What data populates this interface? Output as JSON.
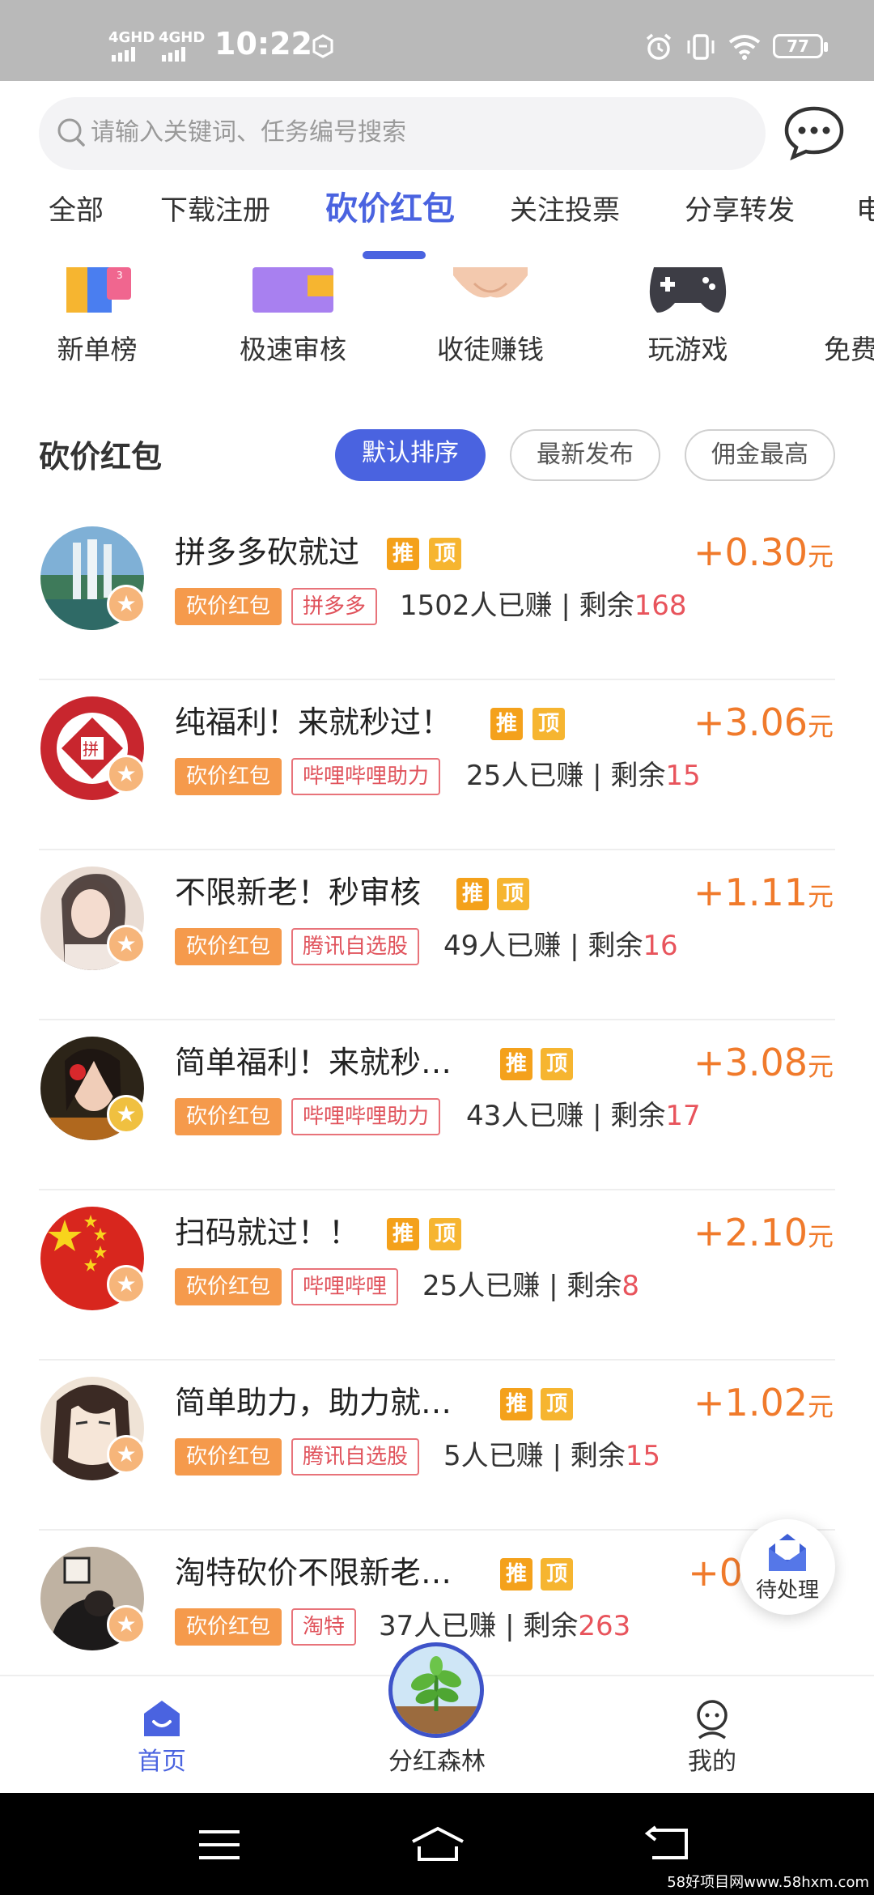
{
  "status_bar": {
    "net1": "4GHD",
    "net2": "4GHD",
    "time": "10:22",
    "battery": "77"
  },
  "search": {
    "placeholder": "请输入关键词、任务编号搜索"
  },
  "tabs": [
    {
      "label": "全部"
    },
    {
      "label": "下载注册"
    },
    {
      "label": "砍价红包",
      "active": true
    },
    {
      "label": "关注投票"
    },
    {
      "label": "分享转发"
    },
    {
      "label": "电"
    }
  ],
  "categories": [
    {
      "label": "新单榜",
      "icon": "trophy-book-icon"
    },
    {
      "label": "极速审核",
      "icon": "purple-folder-icon"
    },
    {
      "label": "收徒赚钱",
      "icon": "handshake-icon"
    },
    {
      "label": "玩游戏",
      "icon": "gamepad-icon"
    },
    {
      "label": "免费",
      "icon": "orange-card-icon"
    }
  ],
  "section": {
    "title": "砍价红包",
    "sort_options": [
      {
        "label": "默认排序",
        "active": true
      },
      {
        "label": "最新发布",
        "active": false
      },
      {
        "label": "佣金最高",
        "active": false
      }
    ]
  },
  "task_badges": {
    "tui": "推",
    "ding": "顶"
  },
  "tasks": [
    {
      "title": "拼多多砍就过",
      "price": "+0.30",
      "unit": "元",
      "tag1": "砍价红包",
      "tag2": "拼多多",
      "earned": "1502人已赚 | 剩余",
      "remaining": "168",
      "avatar": "waterfall"
    },
    {
      "title": "纯福利！来就秒过！",
      "price": "+3.06",
      "unit": "元",
      "tag1": "砍价红包",
      "tag2": "哔哩哔哩助力",
      "earned": "25人已赚 | 剩余",
      "remaining": "15",
      "avatar": "red-pattern"
    },
    {
      "title": "不限新老！秒审核",
      "price": "+1.11",
      "unit": "元",
      "tag1": "砍价红包",
      "tag2": "腾讯自选股",
      "earned": "49人已赚 | 剩余",
      "remaining": "16",
      "avatar": "girl-photo"
    },
    {
      "title": "简单福利！来就秒…",
      "price": "+3.08",
      "unit": "元",
      "tag1": "砍价红包",
      "tag2": "哔哩哔哩助力",
      "earned": "43人已赚 | 剩余",
      "remaining": "17",
      "avatar": "flower-girl"
    },
    {
      "title": "扫码就过！！",
      "price": "+2.10",
      "unit": "元",
      "tag1": "砍价红包",
      "tag2": "哔哩哔哩",
      "earned": "25人已赚 | 剩余",
      "remaining": "8",
      "avatar": "china-flag"
    },
    {
      "title": "简单助力，助力就…",
      "price": "+1.02",
      "unit": "元",
      "tag1": "砍价红包",
      "tag2": "腾讯自选股",
      "earned": "5人已赚 | 剩余",
      "remaining": "15",
      "avatar": "anime-face"
    },
    {
      "title": "淘特砍价不限新老…",
      "price": "+0",
      "unit": "",
      "tag1": "砍价红包",
      "tag2": "淘特",
      "earned": "37人已赚 | 剩余",
      "remaining": "263",
      "avatar": "person-photo"
    }
  ],
  "float_button": {
    "label": "待处理",
    "icon": "envelope-icon"
  },
  "bottom_nav": [
    {
      "label": "首页",
      "icon": "home-icon",
      "active": true
    },
    {
      "label": "分红森林",
      "icon": "sprout-icon",
      "active": false
    },
    {
      "label": "我的",
      "icon": "profile-icon",
      "active": false
    }
  ],
  "watermark": "58好项目网www.58hxm.com",
  "colors": {
    "accent": "#4a63e0",
    "price": "#f07a2b",
    "tag_fill": "#f59a4c",
    "tag_outline": "#e0525b",
    "remaining": "#e8545c"
  }
}
